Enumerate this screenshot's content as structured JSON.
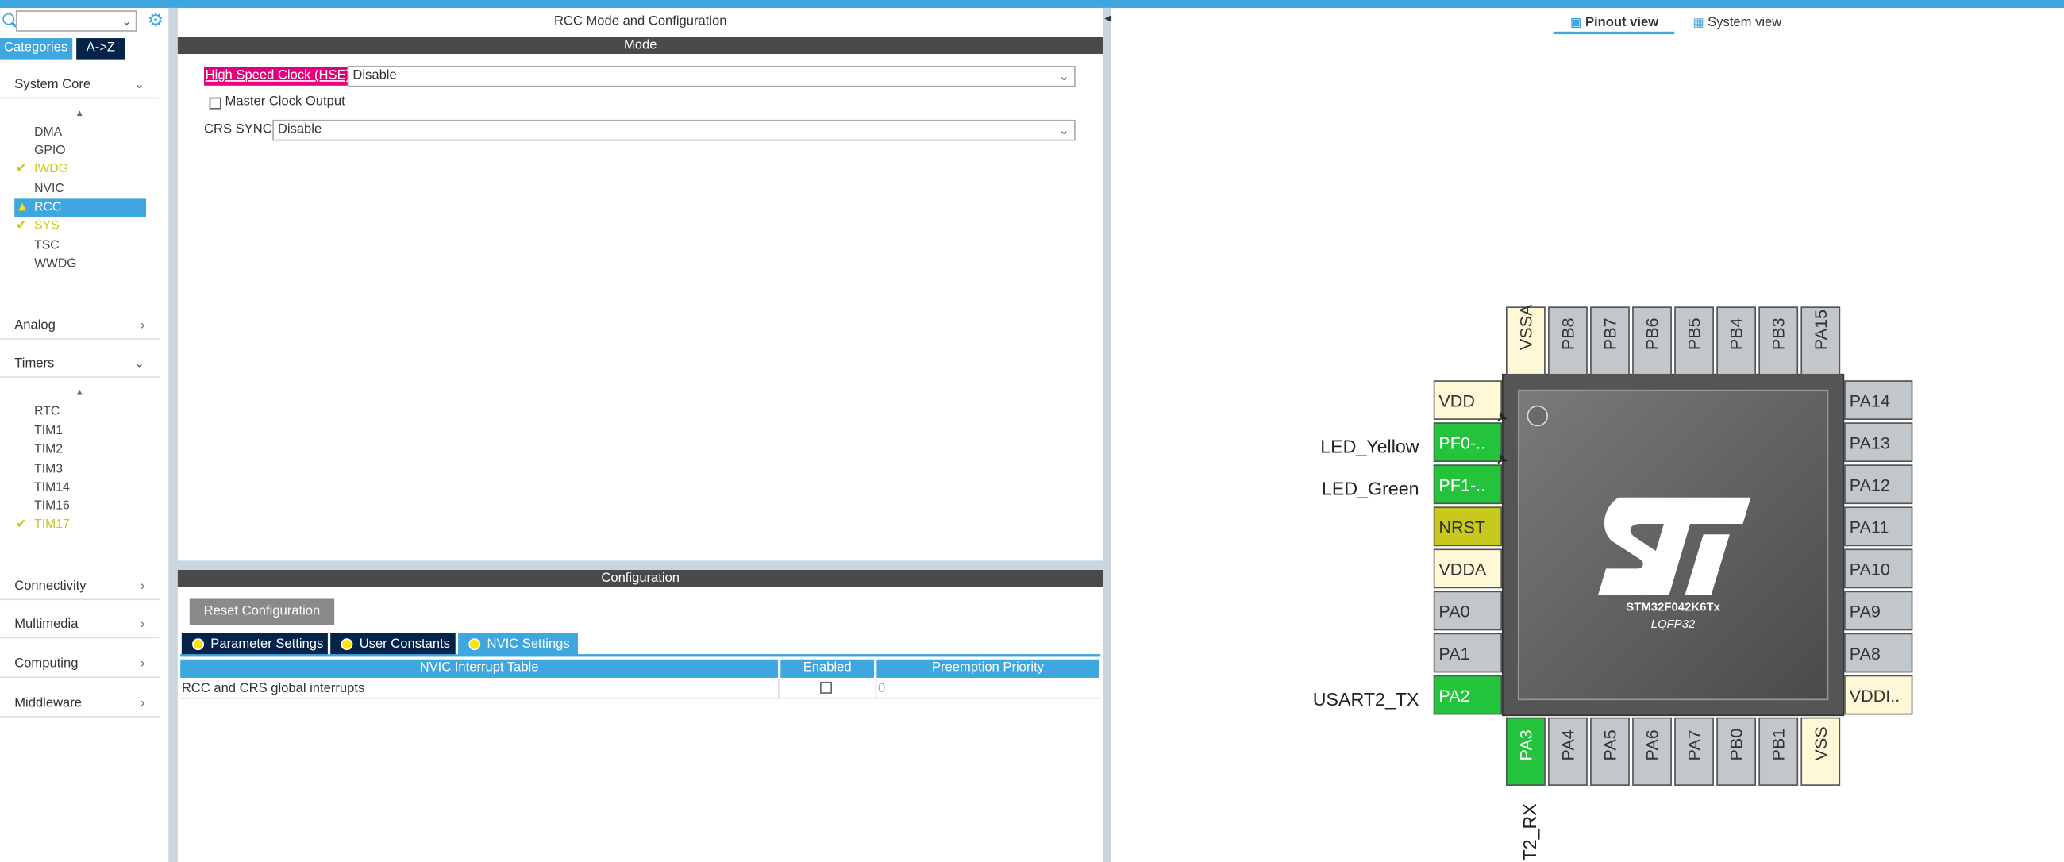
{
  "left_panel": {
    "search_value": "",
    "tab_categories": "Categories",
    "tab_az": "A->Z",
    "categories": [
      {
        "label": "System Core",
        "expanded": true,
        "items": [
          {
            "label": "DMA",
            "status": "none"
          },
          {
            "label": "GPIO",
            "status": "none"
          },
          {
            "label": "IWDG",
            "status": "ok"
          },
          {
            "label": "NVIC",
            "status": "none"
          },
          {
            "label": "RCC",
            "status": "warning",
            "selected": true
          },
          {
            "label": "SYS",
            "status": "ok"
          },
          {
            "label": "TSC",
            "status": "none"
          },
          {
            "label": "WWDG",
            "status": "none"
          }
        ]
      },
      {
        "label": "Analog",
        "expanded": false
      },
      {
        "label": "Timers",
        "expanded": true,
        "items": [
          {
            "label": "RTC",
            "status": "none"
          },
          {
            "label": "TIM1",
            "status": "none"
          },
          {
            "label": "TIM2",
            "status": "none"
          },
          {
            "label": "TIM3",
            "status": "none"
          },
          {
            "label": "TIM14",
            "status": "none"
          },
          {
            "label": "TIM16",
            "status": "none"
          },
          {
            "label": "TIM17",
            "status": "ok"
          }
        ]
      },
      {
        "label": "Connectivity",
        "expanded": false
      },
      {
        "label": "Multimedia",
        "expanded": false
      },
      {
        "label": "Computing",
        "expanded": false
      },
      {
        "label": "Middleware",
        "expanded": false
      }
    ]
  },
  "mode_panel": {
    "title": "RCC Mode and Configuration",
    "mode_header": "Mode",
    "hse_label": "High Speed Clock (HSE)",
    "hse_value": "Disable",
    "mco_label": "Master Clock Output",
    "crs_label": "CRS SYNC",
    "crs_value": "Disable"
  },
  "config_panel": {
    "header": "Configuration",
    "reset_button": "Reset Configuration",
    "tabs": [
      "Parameter Settings",
      "User Constants",
      "NVIC Settings"
    ],
    "active_tab": "NVIC Settings",
    "table": {
      "columns": [
        "NVIC Interrupt Table",
        "Enabled",
        "Preemption Priority"
      ],
      "rows": [
        {
          "name": "RCC and CRS global interrupts",
          "enabled": false,
          "priority": "0"
        }
      ]
    }
  },
  "view_tabs": {
    "pinout": "Pinout view",
    "system": "System view",
    "active": "Pinout view"
  },
  "chip": {
    "name": "STM32F042K6Tx",
    "package": "LQFP32",
    "top_pins": [
      "VSSA",
      "PB8",
      "PB7",
      "PB6",
      "PB5",
      "PB4",
      "PB3",
      "PA15"
    ],
    "left_pins": [
      "VDD",
      "PF0-..",
      "PF1-..",
      "NRST",
      "VDDA",
      "PA0",
      "PA1",
      "PA2"
    ],
    "right_pins": [
      "PA14",
      "PA13",
      "PA12",
      "PA11",
      "PA10",
      "PA9",
      "PA8",
      "VDDI.."
    ],
    "bottom_pins": [
      "PA3",
      "PA4",
      "PA5",
      "PA6",
      "PA7",
      "PB0",
      "PB1",
      "VSS"
    ],
    "signals": {
      "led_yellow": "LED_Yellow",
      "led_green": "LED_Green",
      "usart_tx": "USART2_TX",
      "usart_rx": "T2_RX"
    }
  },
  "colors": {
    "accent": "#3ea7e0",
    "pin_assigned": "#24c33c",
    "pin_power": "#fff8d6",
    "pin_default": "#c1c7cb",
    "hse_highlight": "#e4007c"
  }
}
